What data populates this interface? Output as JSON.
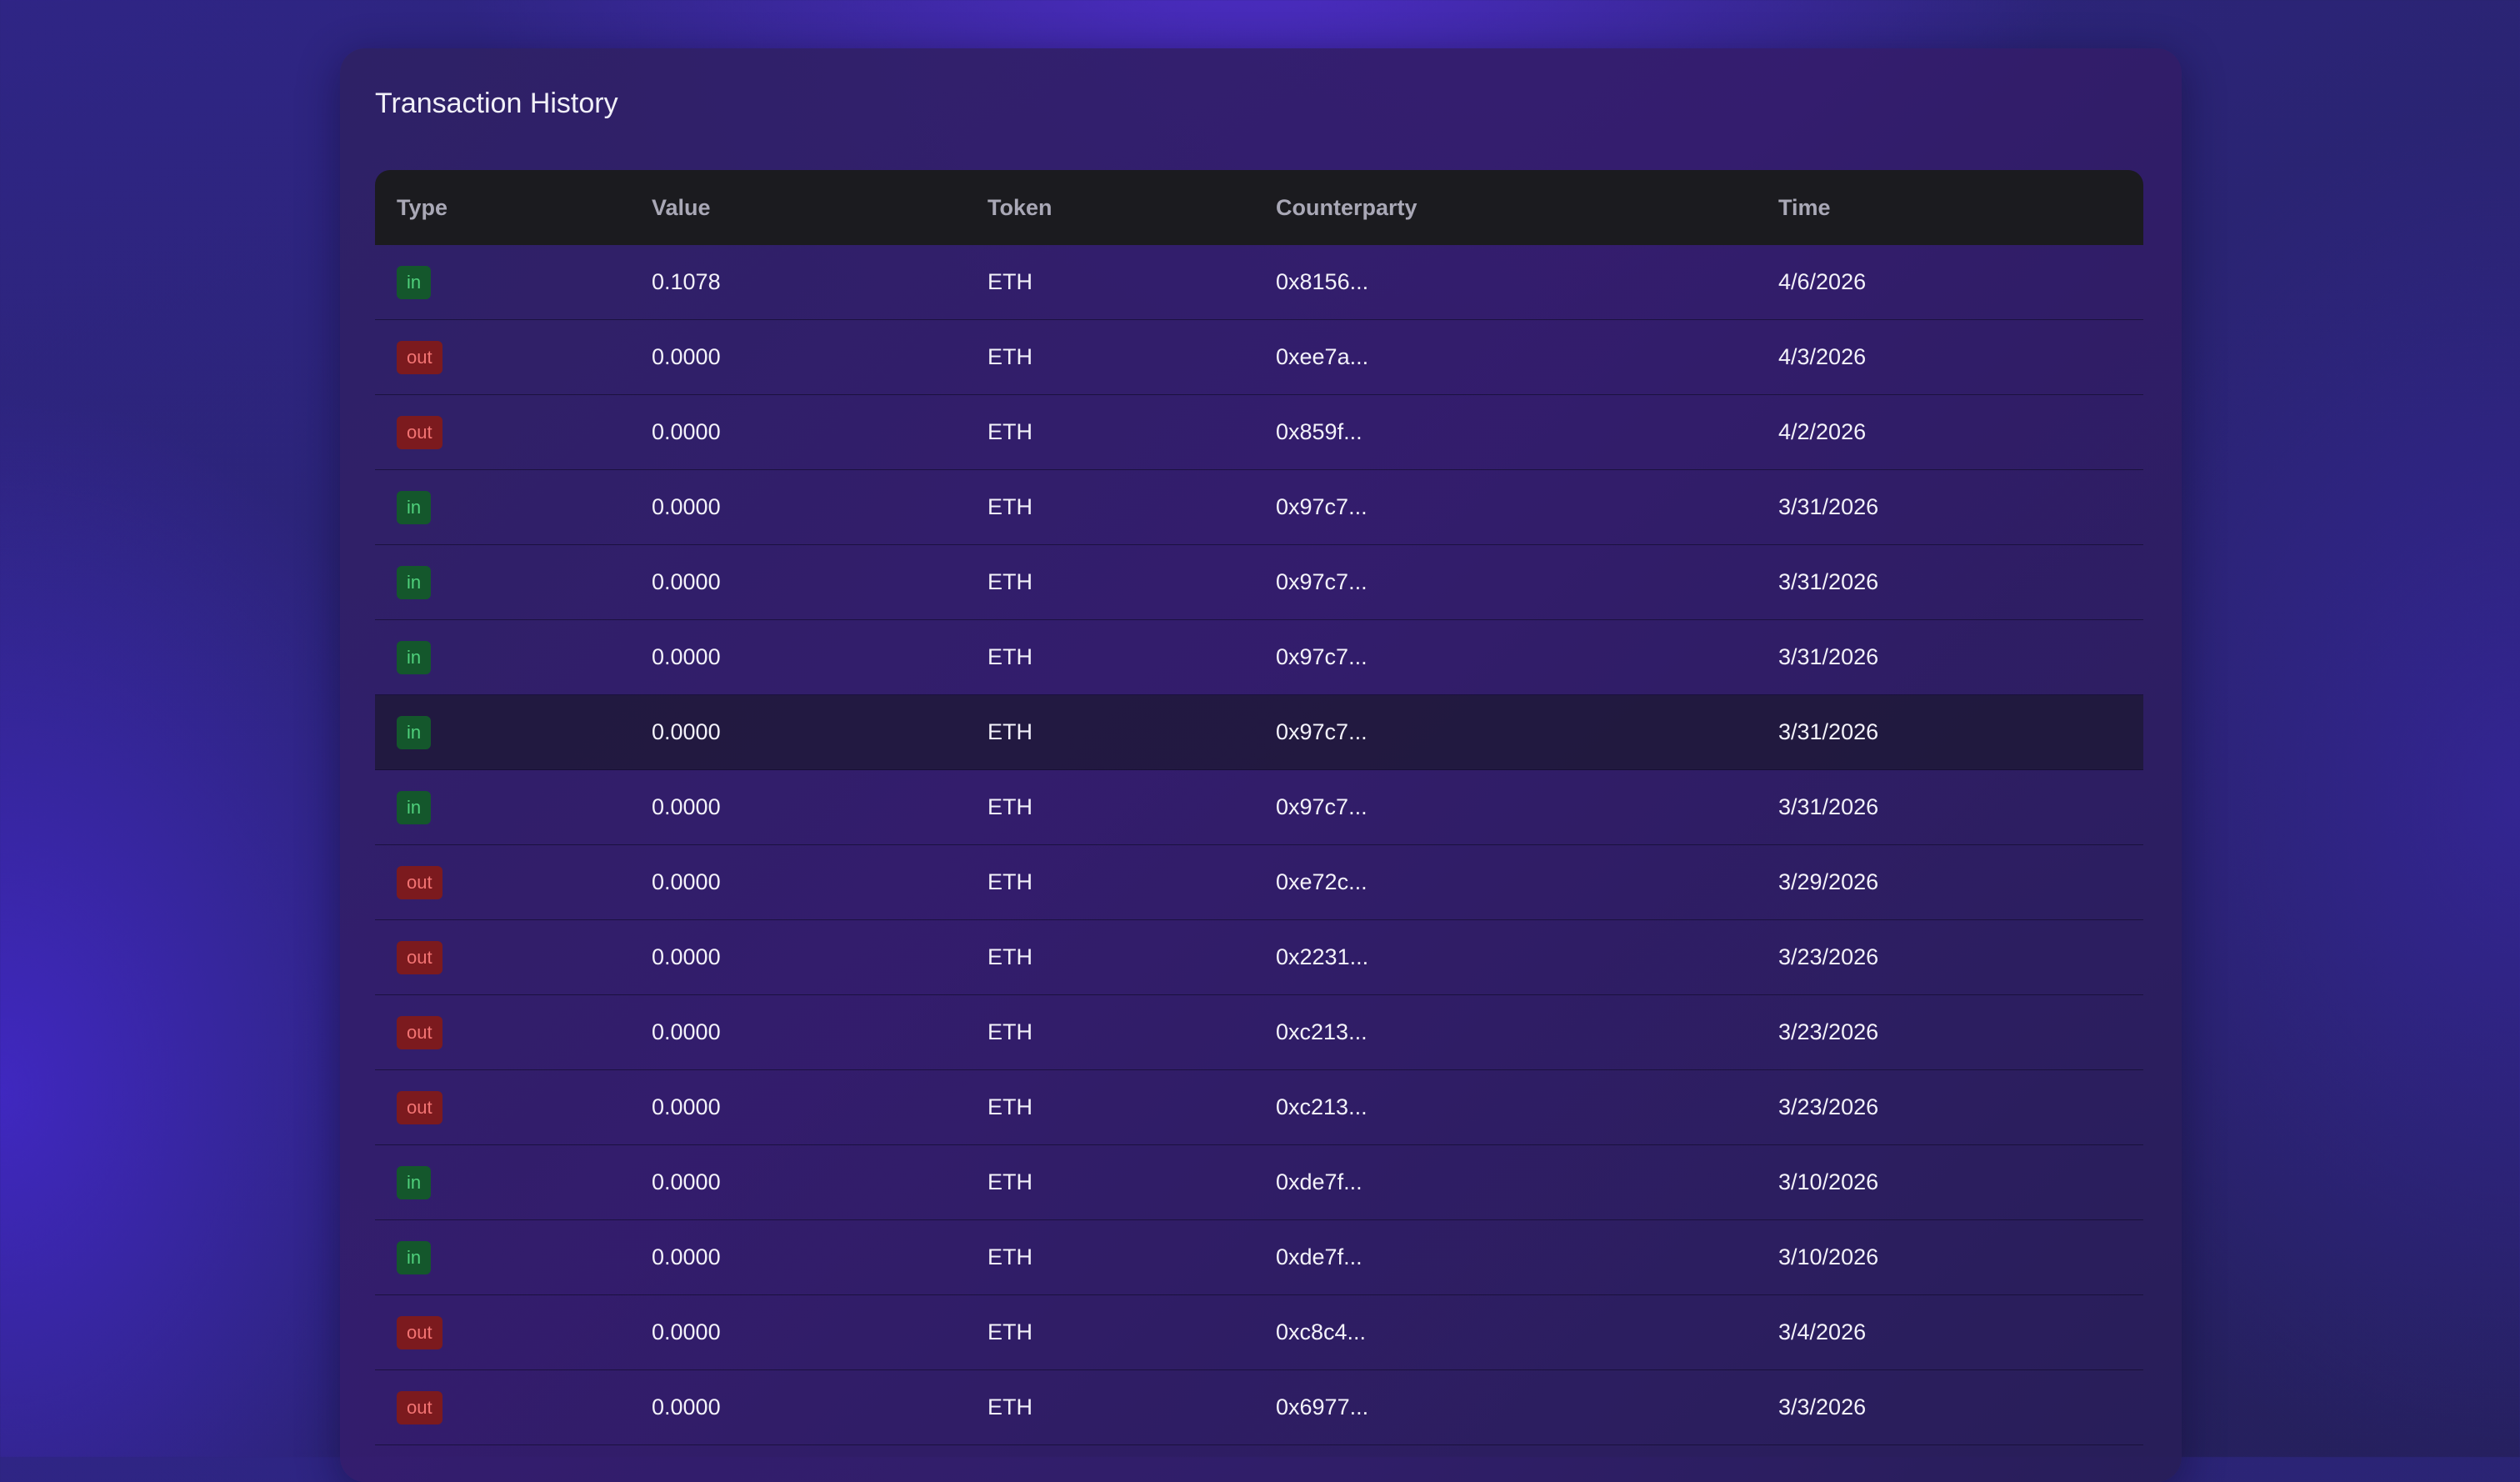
{
  "panel": {
    "title": "Transaction History"
  },
  "colors": {
    "in_badge_bg": "#14572c",
    "in_badge_text": "#4fd07b",
    "out_badge_bg": "#7c1a1e",
    "out_badge_text": "#f37473",
    "table_header_bg": "#1b1b1f"
  },
  "table": {
    "columns": [
      "Type",
      "Value",
      "Token",
      "Counterparty",
      "Time"
    ],
    "highlighted_row": 6,
    "rows": [
      {
        "type": "in",
        "value": "0.1078",
        "token": "ETH",
        "counterparty": "0x8156...",
        "time": "4/6/2026"
      },
      {
        "type": "out",
        "value": "0.0000",
        "token": "ETH",
        "counterparty": "0xee7a...",
        "time": "4/3/2026"
      },
      {
        "type": "out",
        "value": "0.0000",
        "token": "ETH",
        "counterparty": "0x859f...",
        "time": "4/2/2026"
      },
      {
        "type": "in",
        "value": "0.0000",
        "token": "ETH",
        "counterparty": "0x97c7...",
        "time": "3/31/2026"
      },
      {
        "type": "in",
        "value": "0.0000",
        "token": "ETH",
        "counterparty": "0x97c7...",
        "time": "3/31/2026"
      },
      {
        "type": "in",
        "value": "0.0000",
        "token": "ETH",
        "counterparty": "0x97c7...",
        "time": "3/31/2026"
      },
      {
        "type": "in",
        "value": "0.0000",
        "token": "ETH",
        "counterparty": "0x97c7...",
        "time": "3/31/2026"
      },
      {
        "type": "in",
        "value": "0.0000",
        "token": "ETH",
        "counterparty": "0x97c7...",
        "time": "3/31/2026"
      },
      {
        "type": "out",
        "value": "0.0000",
        "token": "ETH",
        "counterparty": "0xe72c...",
        "time": "3/29/2026"
      },
      {
        "type": "out",
        "value": "0.0000",
        "token": "ETH",
        "counterparty": "0x2231...",
        "time": "3/23/2026"
      },
      {
        "type": "out",
        "value": "0.0000",
        "token": "ETH",
        "counterparty": "0xc213...",
        "time": "3/23/2026"
      },
      {
        "type": "out",
        "value": "0.0000",
        "token": "ETH",
        "counterparty": "0xc213...",
        "time": "3/23/2026"
      },
      {
        "type": "in",
        "value": "0.0000",
        "token": "ETH",
        "counterparty": "0xde7f...",
        "time": "3/10/2026"
      },
      {
        "type": "in",
        "value": "0.0000",
        "token": "ETH",
        "counterparty": "0xde7f...",
        "time": "3/10/2026"
      },
      {
        "type": "out",
        "value": "0.0000",
        "token": "ETH",
        "counterparty": "0xc8c4...",
        "time": "3/4/2026"
      },
      {
        "type": "out",
        "value": "0.0000",
        "token": "ETH",
        "counterparty": "0x6977...",
        "time": "3/3/2026"
      }
    ]
  }
}
